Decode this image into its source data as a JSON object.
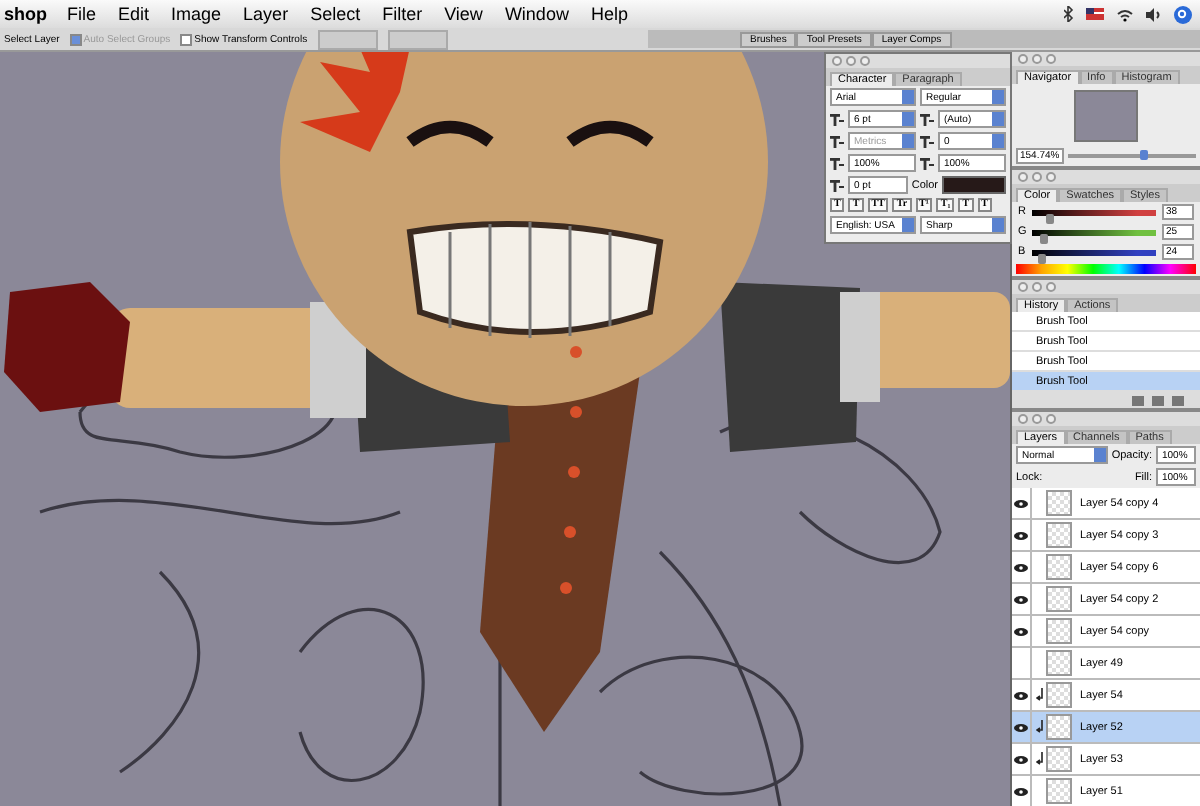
{
  "menu_bar": {
    "app_name": "shop",
    "items": [
      "File",
      "Edit",
      "Image",
      "Layer",
      "Select",
      "Filter",
      "View",
      "Window",
      "Help"
    ]
  },
  "options_bar": {
    "label": "Select Layer",
    "checkboxes": [
      {
        "label": "Auto Select Groups",
        "checked": true,
        "disabled": true
      },
      {
        "label": "Show Transform Controls",
        "checked": false,
        "disabled": false
      }
    ],
    "palette_well": [
      "Brushes",
      "Tool Presets",
      "Layer Comps"
    ]
  },
  "character_panel": {
    "tabs": [
      {
        "label": "Character",
        "selected": true
      },
      {
        "label": "Paragraph",
        "selected": false
      }
    ],
    "font": "Arial",
    "style": "Regular",
    "size": "6 pt",
    "leading": "(Auto)",
    "kerning": "Metrics",
    "tracking": "0",
    "vertical_scale": "100%",
    "horizontal_scale": "100%",
    "baseline_shift": "0 pt",
    "color_label": "Color",
    "style_buttons": [
      "T",
      "T",
      "TT",
      "Tr",
      "T¹",
      "T₁",
      "T",
      "T"
    ],
    "language": "English: USA",
    "antialias": "Sharp"
  },
  "navigator": {
    "tabs": [
      {
        "label": "Navigator",
        "selected": true
      },
      {
        "label": "Info",
        "selected": false
      },
      {
        "label": "Histogram",
        "selected": false
      }
    ],
    "zoom": "154.74%",
    "level": 0.6
  },
  "color_panel": {
    "tabs": [
      {
        "label": "Color",
        "selected": true
      },
      {
        "label": "Swatches",
        "selected": false
      },
      {
        "label": "Styles",
        "selected": false
      }
    ],
    "channels": [
      {
        "name": "R",
        "value": "38",
        "level": 0.15,
        "color": "#d04040"
      },
      {
        "name": "G",
        "value": "25",
        "level": 0.1,
        "color": "#70c040"
      },
      {
        "name": "B",
        "value": "24",
        "level": 0.09,
        "color": "#3040c0"
      }
    ]
  },
  "history": {
    "tabs": [
      {
        "label": "History",
        "selected": true
      },
      {
        "label": "Actions",
        "selected": false
      }
    ],
    "items": [
      {
        "label": "Brush Tool",
        "selected": false
      },
      {
        "label": "Brush Tool",
        "selected": false
      },
      {
        "label": "Brush Tool",
        "selected": false
      },
      {
        "label": "Brush Tool",
        "selected": true
      }
    ]
  },
  "layers": {
    "tabs": [
      {
        "label": "Layers",
        "selected": true
      },
      {
        "label": "Channels",
        "selected": false
      },
      {
        "label": "Paths",
        "selected": false
      }
    ],
    "blend_mode": "Normal",
    "opacity_label": "Opacity:",
    "opacity": "100%",
    "lock_label": "Lock:",
    "fill_label": "Fill:",
    "fill": "100%",
    "items": [
      {
        "name": "Layer 54 copy 4",
        "visible": true,
        "selected": false,
        "clipped": false
      },
      {
        "name": "Layer 54 copy 3",
        "visible": true,
        "selected": false,
        "clipped": false
      },
      {
        "name": "Layer 54 copy 6",
        "visible": true,
        "selected": false,
        "clipped": false
      },
      {
        "name": "Layer 54 copy 2",
        "visible": true,
        "selected": false,
        "clipped": false
      },
      {
        "name": "Layer 54 copy",
        "visible": true,
        "selected": false,
        "clipped": false
      },
      {
        "name": "Layer 49",
        "visible": false,
        "selected": false,
        "clipped": false
      },
      {
        "name": "Layer 54",
        "visible": true,
        "selected": false,
        "clipped": true
      },
      {
        "name": "Layer 52",
        "visible": true,
        "selected": true,
        "clipped": true
      },
      {
        "name": "Layer 53",
        "visible": true,
        "selected": false,
        "clipped": true
      },
      {
        "name": "Layer 51",
        "visible": true,
        "selected": false,
        "clipped": false
      }
    ]
  }
}
